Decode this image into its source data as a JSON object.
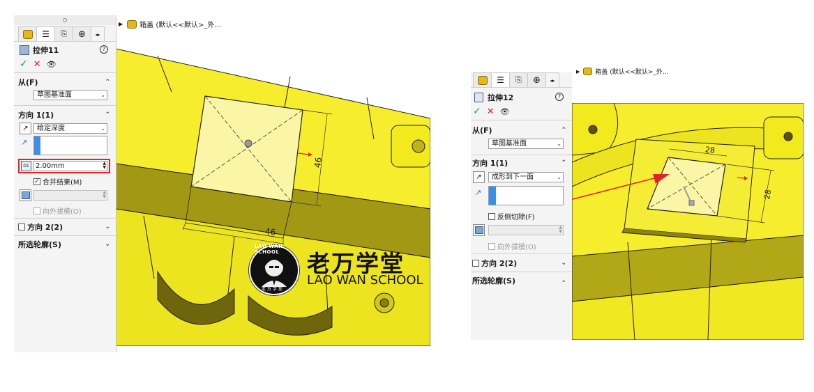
{
  "colors": {
    "accent_blue": "#3e8ee8",
    "confirm_green": "#29a329",
    "cancel_red": "#e02020",
    "highlight_red": "#e02424",
    "part_yellow": "#f2ea1c"
  },
  "left": {
    "tree": {
      "label": "箱盖 (默认<<默认>_外..."
    },
    "feature": {
      "title": "拉伸11",
      "help": "?"
    },
    "from": {
      "header": "从(F)",
      "value": "草图基准面"
    },
    "dir1": {
      "header": "方向 1(1)",
      "end_condition": "给定深度",
      "depth": "2.00mm",
      "merge": "合并结果(M)",
      "draft": "向外拔模(O)"
    },
    "dir2": {
      "header": "方向 2(2)"
    },
    "contours": {
      "header": "所选轮廓(S)"
    },
    "dims": {
      "vertical": "46",
      "horizontal": "46"
    }
  },
  "right": {
    "tree": {
      "label": "箱盖 (默认<<默认>_外..."
    },
    "feature": {
      "title": "拉伸12",
      "help": "?"
    },
    "from": {
      "header": "从(F)",
      "value": "草图基准面"
    },
    "dir1": {
      "header": "方向 1(1)",
      "end_condition": "成形到下一面",
      "reverse_cut": "反侧切除(F)",
      "draft": "向外拔模(O)"
    },
    "dir2": {
      "header": "方向 2(2)"
    },
    "contours": {
      "header": "所选轮廓(S)"
    },
    "dims": {
      "top": "28",
      "side": "28"
    }
  },
  "watermark": {
    "cn": "老万学堂",
    "en": "LAO WAN SCHOOL",
    "badge_ring": "LAO WAN SCHOOL",
    "badge_bottom": "老 万 学 堂"
  }
}
